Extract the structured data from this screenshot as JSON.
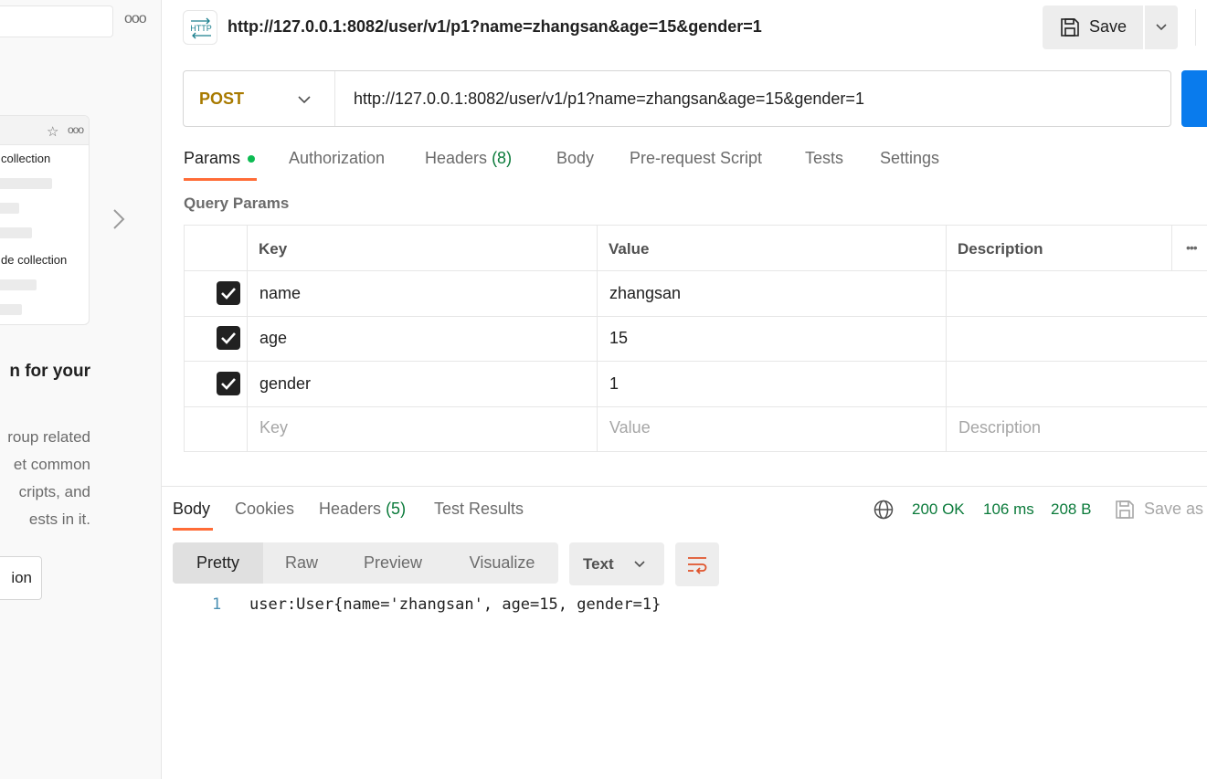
{
  "sidebar": {
    "more_label": "ooo",
    "card": {
      "more_label": "ooo",
      "item1": "collection",
      "item2": "de collection"
    },
    "heading": "n for your",
    "paragraph": [
      "roup related",
      "et common",
      "cripts, and",
      "ests in it."
    ],
    "create_button": "ion"
  },
  "request": {
    "title": "http://127.0.0.1:8082/user/v1/p1?name=zhangsan&age=15&gender=1",
    "save_label": "Save",
    "method": "POST",
    "url": "http://127.0.0.1:8082/user/v1/p1?name=zhangsan&age=15&gender=1",
    "tabs": {
      "params": "Params",
      "authorization": "Authorization",
      "headers": "Headers",
      "headers_count": "(8)",
      "body": "Body",
      "prerequest": "Pre-request Script",
      "tests": "Tests",
      "settings": "Settings"
    }
  },
  "query_params": {
    "label": "Query Params",
    "columns": {
      "key": "Key",
      "value": "Value",
      "description": "Description"
    },
    "rows": [
      {
        "key": "name",
        "value": "zhangsan",
        "description": "",
        "checked": true
      },
      {
        "key": "age",
        "value": "15",
        "description": "",
        "checked": true
      },
      {
        "key": "gender",
        "value": "1",
        "description": "",
        "checked": true
      }
    ],
    "placeholder": {
      "key": "Key",
      "value": "Value",
      "description": "Description"
    }
  },
  "response": {
    "tabs": {
      "body": "Body",
      "cookies": "Cookies",
      "headers": "Headers",
      "headers_count": "(5)",
      "test_results": "Test Results"
    },
    "status": "200 OK",
    "time": "106 ms",
    "size": "208 B",
    "save_as": "Save as",
    "views": {
      "pretty": "Pretty",
      "raw": "Raw",
      "preview": "Preview",
      "visualize": "Visualize"
    },
    "format": "Text",
    "lines": [
      {
        "number": "1",
        "text": "user:User{name='zhangsan', age=15, gender=1}"
      }
    ]
  },
  "colors": {
    "accent": "#ff6c37",
    "method_post": "#a87a00",
    "status_green": "#0a7a3a",
    "send_blue": "#097bed"
  }
}
